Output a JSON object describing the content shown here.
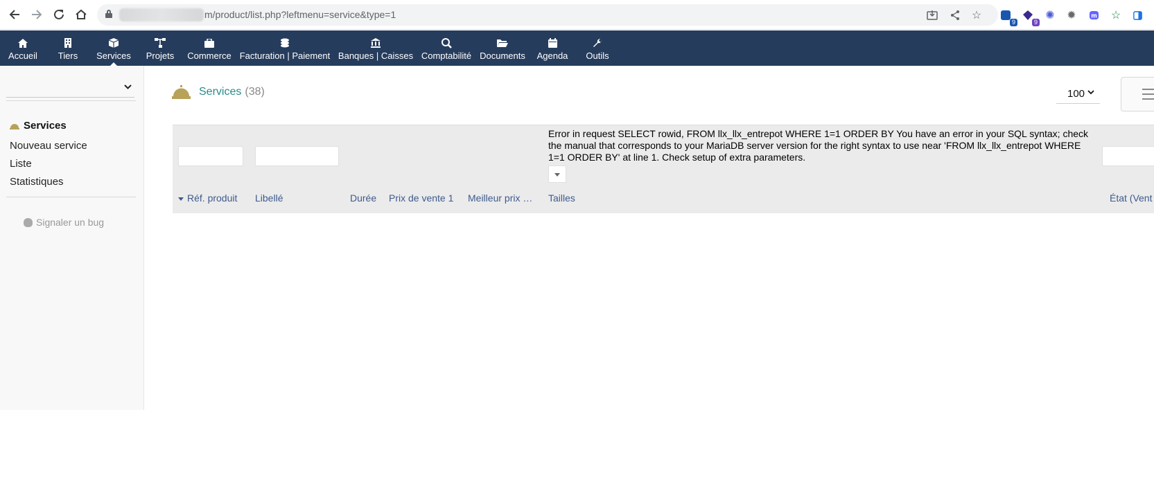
{
  "browser": {
    "url_path": "m/product/list.php?leftmenu=service&type=1",
    "extensions": [
      {
        "name": "extension-1",
        "badge": "9",
        "color": "#1a56b0",
        "badge_color": "#1a56b0"
      },
      {
        "name": "extension-2",
        "badge": "9",
        "color": "#3a2a8c",
        "badge_color": "#6f42c1"
      }
    ]
  },
  "topmenu": {
    "items": [
      {
        "label": "Accueil",
        "icon": "home-icon"
      },
      {
        "label": "Tiers",
        "icon": "building-icon"
      },
      {
        "label": "Services",
        "icon": "cube-icon"
      },
      {
        "label": "Projets",
        "icon": "sitemap-icon"
      },
      {
        "label": "Commerce",
        "icon": "briefcase-icon"
      },
      {
        "label": "Facturation | Paiement",
        "icon": "coins-icon"
      },
      {
        "label": "Banques | Caisses",
        "icon": "bank-icon"
      },
      {
        "label": "Comptabilité",
        "icon": "search-dollar-icon"
      },
      {
        "label": "Documents",
        "icon": "folder-open-icon"
      },
      {
        "label": "Agenda",
        "icon": "calendar-icon"
      },
      {
        "label": "Outils",
        "icon": "wrench-icon"
      }
    ],
    "active": "Services"
  },
  "sidebar": {
    "select_value": "",
    "title": "Services",
    "links": [
      "Nouveau service",
      "Liste",
      "Statistiques"
    ],
    "bug_link": "Signaler un bug"
  },
  "main": {
    "title": "Services",
    "count": "(38)",
    "limit": "100",
    "error": "Error in request SELECT rowid, FROM llx_llx_entrepot WHERE 1=1 ORDER BY You have an error in your SQL syntax; check the manual that corresponds to your MariaDB server version for the right syntax to use near 'FROM llx_llx_entrepot WHERE 1=1 ORDER BY' at line 1. Check setup of extra parameters.",
    "columns": [
      "Réf. produit",
      "Libellé",
      "Durée",
      "Prix de vente 1",
      "Meilleur prix …",
      "Tailles",
      "État (Vent"
    ]
  },
  "colors": {
    "topbar": "#263c5c",
    "title_link": "#2a8a8a",
    "column_header": "#3d5a8a",
    "bell": "#b8a25a"
  }
}
